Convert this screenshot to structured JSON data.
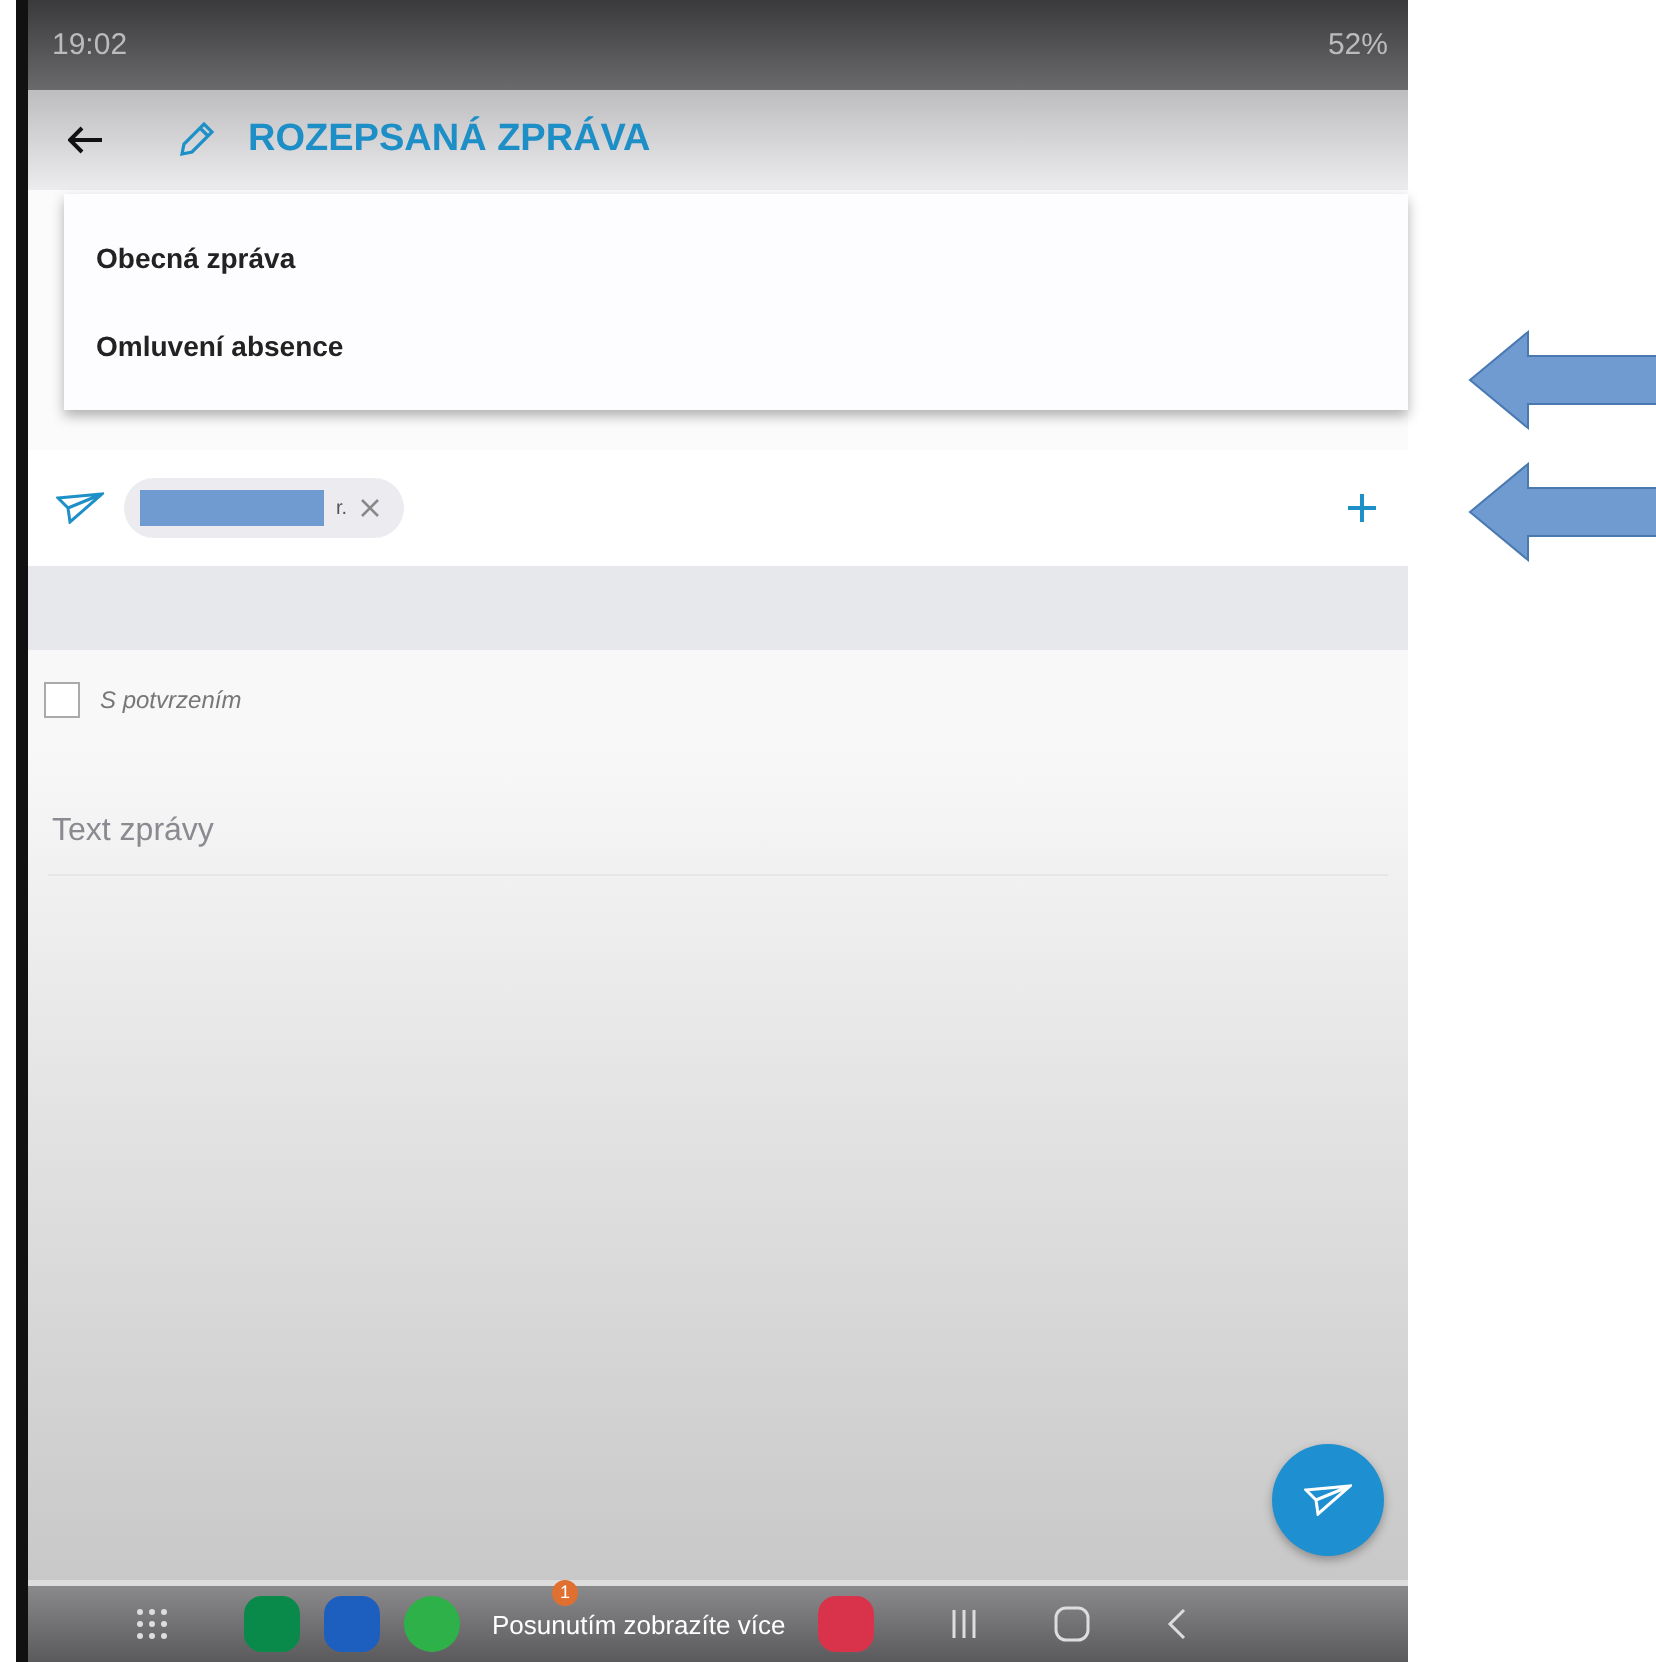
{
  "status_bar": {
    "time": "19:02",
    "battery": "52%"
  },
  "header": {
    "title": "ROZEPSANÁ ZPRÁVA"
  },
  "dropdown": {
    "items": [
      {
        "label": "Obecná zpráva",
        "selected": false
      },
      {
        "label": "Omluvení absence",
        "selected": false
      }
    ]
  },
  "recipient": {
    "chip_text": "r."
  },
  "confirm": {
    "label": "S potvrzením",
    "checked": false
  },
  "message": {
    "placeholder": "Text zprávy"
  },
  "taskbar": {
    "hint": "Posunutím zobrazíte více",
    "badge": "1"
  }
}
